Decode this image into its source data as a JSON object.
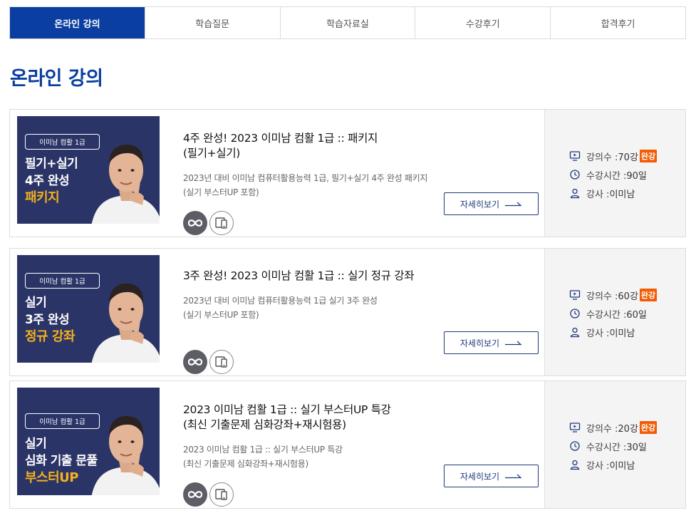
{
  "tabs": [
    "온라인 강의",
    "학습질문",
    "학습자료실",
    "수강후기",
    "합격후기"
  ],
  "page_title": "온라인 강의",
  "colors": {
    "brand": "#0b3ea1",
    "thumb_bg": "#2b3467",
    "highlight": "#f6b21b",
    "complete_tag": "#f25c05"
  },
  "courses": [
    {
      "thumb": {
        "badge": "이미남 컴활 1급",
        "line1": "필기+실기",
        "line2": "4주 완성",
        "line3": "패키지"
      },
      "title": "4주 완성! 2023 이미남 컴활 1급 :: 패키지\n(필기+실기)",
      "desc": "2023년 대비 이미남 컴퓨터활용능력 1급, 필기+실기 4주 완성 패키지\n(실기 부스터UP 포함)",
      "button": "자세히보기",
      "lecture_count_label": "강의수 : ",
      "lecture_count": "70강",
      "complete_tag": "완강",
      "period_label": "수강시간 : ",
      "period": "90일",
      "teacher_label": "강사 : ",
      "teacher": "이미남"
    },
    {
      "thumb": {
        "badge": "이미남 컴활 1급",
        "line1": "실기",
        "line2": "3주 완성",
        "line3": "정규 강좌"
      },
      "title": "3주 완성! 2023 이미남 컴활 1급 :: 실기 정규 강좌",
      "desc": "2023년 대비 이미남 컴퓨터활용능력 1급 실기 3주 완성\n(실기 부스터UP 포함)",
      "button": "자세히보기",
      "lecture_count_label": "강의수 : ",
      "lecture_count": "60강",
      "complete_tag": "완강",
      "period_label": "수강시간 : ",
      "period": "60일",
      "teacher_label": "강사 : ",
      "teacher": "이미남"
    },
    {
      "thumb": {
        "badge": "이미남 컴활 1급",
        "line1": "실기",
        "line2": "심화 기출 문풀",
        "line3": "부스터UP"
      },
      "title": "2023 이미남 컴활 1급 :: 실기 부스터UP 특강\n(최신 기출문제 심화강좌+재시험용)",
      "desc": "2023 이미남 컴활 1급 :: 실기 부스터UP 특강\n(최신 기출문제 심화강좌+재시험용)",
      "button": "자세히보기",
      "lecture_count_label": "강의수 : ",
      "lecture_count": "20강",
      "complete_tag": "완강",
      "period_label": "수강시간 : ",
      "period": "30일",
      "teacher_label": "강사 : ",
      "teacher": "이미남"
    }
  ]
}
